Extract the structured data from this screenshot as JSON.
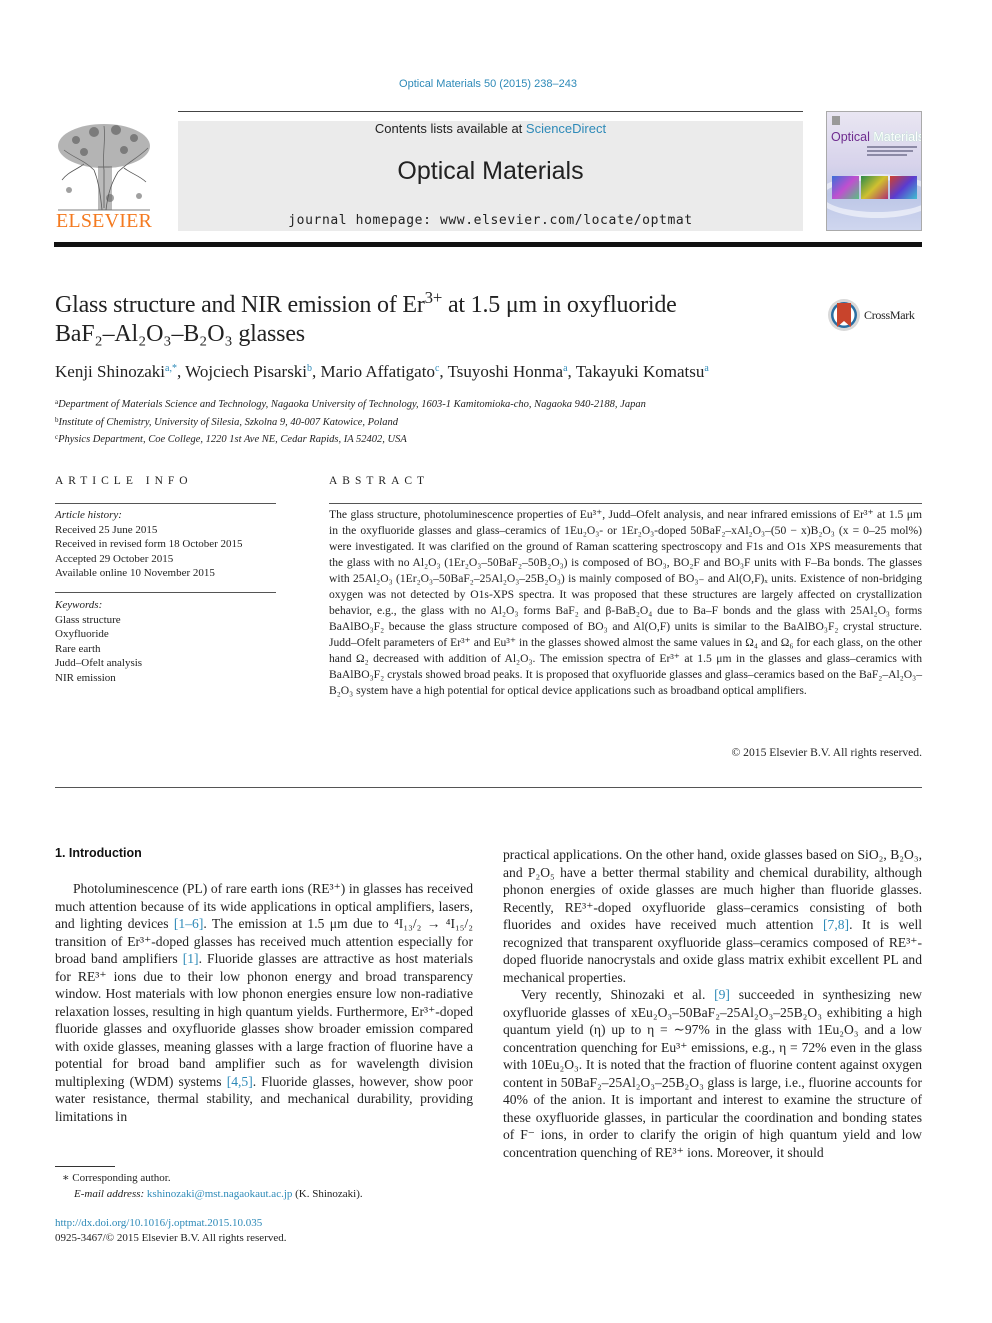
{
  "header": {
    "journal_ref": "Optical Materials 50 (2015) 238–243",
    "contents_prefix": "Contents lists available at ",
    "contents_link": "ScienceDirect",
    "journal_title": "Optical Materials",
    "homepage_prefix": "journal homepage: ",
    "homepage_url": "www.elsevier.com/locate/optmat",
    "publisher_logo": "ELSEVIER",
    "cover_title_part1": "Optical",
    "cover_title_part2": "Materials",
    "colors": {
      "link": "#2e8ab8",
      "elsevier_orange": "#f47a20",
      "masthead_bg": "#ebebeb"
    }
  },
  "article": {
    "title_part1": "Glass structure and NIR emission of Er",
    "title_sup": "3+",
    "title_part2": " at 1.5 μm in oxyfluoride",
    "title_line2": "BaF₂–Al₂O₃–B₂O₃ glasses",
    "crossmark_label": "CrossMark",
    "authors": [
      {
        "name": "Kenji Shinozaki",
        "aff": "a,*"
      },
      {
        "name": "Wojciech Pisarski",
        "aff": "b"
      },
      {
        "name": "Mario Affatigato",
        "aff": "c"
      },
      {
        "name": "Tsuyoshi Honma",
        "aff": "a"
      },
      {
        "name": "Takayuki Komatsu",
        "aff": "a"
      }
    ],
    "affiliations": [
      {
        "mark": "a",
        "text": "Department of Materials Science and Technology, Nagaoka University of Technology, 1603-1 Kamitomioka-cho, Nagaoka 940-2188, Japan"
      },
      {
        "mark": "b",
        "text": "Institute of Chemistry, University of Silesia, Szkolna 9, 40-007 Katowice, Poland"
      },
      {
        "mark": "c",
        "text": "Physics Department, Coe College, 1220 1st Ave NE, Cedar Rapids, IA 52402, USA"
      }
    ]
  },
  "article_info": {
    "heading": "ARTICLE INFO",
    "history_label": "Article history:",
    "history": [
      "Received 25 June 2015",
      "Received in revised form 18 October 2015",
      "Accepted 29 October 2015",
      "Available online 10 November 2015"
    ],
    "keywords_label": "Keywords:",
    "keywords": [
      "Glass structure",
      "Oxyfluoride",
      "Rare earth",
      "Judd–Ofelt analysis",
      "NIR emission"
    ]
  },
  "abstract": {
    "heading": "ABSTRACT",
    "text": "The glass structure, photoluminescence properties of Eu³⁺, Judd–Ofelt analysis, and near infrared emissions of Er³⁺ at 1.5 μm in the oxyfluoride glasses and glass–ceramics of 1Eu₂O₃- or 1Er₂O₃-doped 50BaF₂–xAl₂O₃–(50 − x)B₂O₃ (x = 0–25 mol%) were investigated. It was clarified on the ground of Raman scattering spectroscopy and F1s and O1s XPS measurements that the glass with no Al₂O₃ (1Er₂O₃–50BaF₂–50B₂O₃) is composed of BO₃, BO₂F and BO₃F units with F–Ba bonds. The glasses with 25Al₂O₃ (1Er₂O₃–50BaF₂–25Al₂O₃–25B₂O₃) is mainly composed of BO₃₋ and Al(O,F)ₓ units. Existence of non-bridging oxygen was not detected by O1s-XPS spectra. It was proposed that these structures are largely affected on crystallization behavior, e.g., the glass with no Al₂O₃ forms BaF₂ and β-BaB₂O₄ due to Ba–F bonds and the glass with 25Al₂O₃ forms BaAlBO₃F₂ because the glass structure composed of BO₃ and Al(O,F) units is similar to the BaAlBO₃F₂ crystal structure. Judd–Ofelt parameters of Er³⁺ and Eu³⁺ in the glasses showed almost the same values in Ω₄ and Ω₆ for each glass, on the other hand Ω₂ decreased with addition of Al₂O₃. The emission spectra of Er³⁺ at 1.5 μm in the glasses and glass–ceramics with BaAlBO₃F₂ crystals showed broad peaks. It is proposed that oxyfluoride glasses and glass–ceramics based on the BaF₂–Al₂O₃–B₂O₃ system have a high potential for optical device applications such as broadband optical amplifiers.",
    "copyright": "© 2015 Elsevier B.V. All rights reserved."
  },
  "body": {
    "intro_heading": "1. Introduction",
    "left_p1_a": "Photoluminescence (PL) of rare earth ions (RE³⁺) in glasses has received much attention because of its wide applications in optical amplifiers, lasers, and lighting devices ",
    "left_p1_ref1": "[1–6]",
    "left_p1_b": ". The emission at 1.5 μm due to ⁴I₁₃/₂ → ⁴I₁₅/₂ transition of Er³⁺-doped glasses has received much attention especially for broad band amplifiers ",
    "left_p1_ref2": "[1]",
    "left_p1_c": ". Fluoride glasses are attractive as host materials for RE³⁺ ions due to their low phonon energy and broad transparency window. Host materials with low phonon energies ensure low non-radiative relaxation losses, resulting in high quantum yields. Furthermore, Er³⁺-doped fluoride glasses and oxyfluoride glasses show broader emission compared with oxide glasses, meaning glasses with a large fraction of fluorine have a potential for broad band amplifier such as for wavelength division multiplexing (WDM) systems ",
    "left_p1_ref3": "[4,5]",
    "left_p1_d": ". Fluoride glasses, however, show poor water resistance, thermal stability, and mechanical durability, providing limitations in",
    "right_p1_a": "practical applications. On the other hand, oxide glasses based on SiO₂, B₂O₃, and P₂O₅ have a better thermal stability and chemical durability, although phonon energies of oxide glasses are much higher than fluoride glasses. Recently, RE³⁺-doped oxyfluoride glass–ceramics consisting of both fluorides and oxides have received much attention ",
    "right_p1_ref": "[7,8]",
    "right_p1_b": ". It is well recognized that transparent oxyfluoride glass–ceramics composed of RE³⁺-doped fluoride nanocrystals and oxide glass matrix exhibit excellent PL and mechanical properties.",
    "right_p2_a": "Very recently, Shinozaki et al. ",
    "right_p2_ref": "[9]",
    "right_p2_b": " succeeded in synthesizing new oxyfluoride glasses of xEu₂O₃–50BaF₂–25Al₂O₃–25B₂O₃ exhibiting a high quantum yield (η) up to η = ∼97% in the glass with 1Eu₂O₃ and a low concentration quenching for Eu³⁺ emissions, e.g., η = 72% even in the glass with 10Eu₂O₃. It is noted that the fraction of fluorine content against oxygen content in 50BaF₂–25Al₂O₃–25B₂O₃ glass is large, i.e., fluorine accounts for 40% of the anion. It is important and interest to examine the structure of these oxyfluoride glasses, in particular the coordination and bonding states of F⁻ ions, in order to clarify the origin of high quantum yield and low concentration quenching of RE³⁺ ions. Moreover, it should"
  },
  "footnotes": {
    "corresponding": "∗ Corresponding author.",
    "email_label": "E-mail address: ",
    "email": "kshinozaki@mst.nagaokaut.ac.jp",
    "email_suffix": " (K. Shinozaki).",
    "doi": "http://dx.doi.org/10.1016/j.optmat.2015.10.035",
    "issn_line": "0925-3467/© 2015 Elsevier B.V. All rights reserved."
  }
}
